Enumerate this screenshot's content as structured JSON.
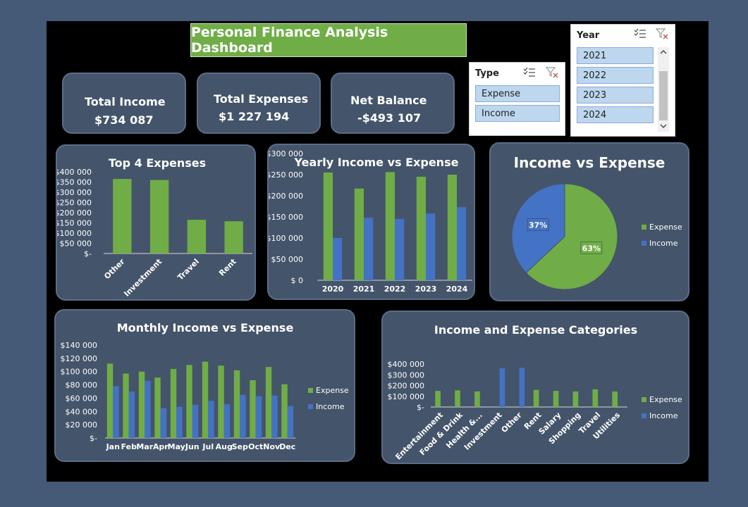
{
  "dashboard_title": "Personal Finance Analysis Dashboard",
  "kpis": {
    "income_label": "Total Income",
    "income_value": "$734 087",
    "expenses_label": "Total Expenses",
    "expenses_value": "$1 227 194",
    "net_label": "Net Balance",
    "net_value": "-$493 107"
  },
  "slicers": {
    "type": {
      "header": "Type",
      "items": [
        "Expense",
        "Income"
      ]
    },
    "year": {
      "header": "Year",
      "items": [
        "2021",
        "2022",
        "2023",
        "2024"
      ]
    }
  },
  "colors": {
    "expense": "#70ad47",
    "income": "#4472c4",
    "card": "#44546a",
    "title_bg": "#70ad47"
  },
  "chart_data": [
    {
      "id": "top4",
      "type": "bar",
      "title": "Top 4 Expenses",
      "categories": [
        "Other",
        "Investment",
        "Travel",
        "Rent"
      ],
      "values": [
        365000,
        360000,
        165000,
        158000
      ],
      "yticks": [
        "$400 000",
        "$350 000",
        "$300 000",
        "$250 000",
        "$200 000",
        "$150 000",
        "$100 000",
        "$50 000",
        "$-"
      ],
      "ylim": [
        0,
        400000
      ],
      "grid": false
    },
    {
      "id": "yearly",
      "type": "bar",
      "title": "Yearly Income vs Expense",
      "categories": [
        "2020",
        "2021",
        "2022",
        "2023",
        "2024"
      ],
      "series": [
        {
          "name": "Expense",
          "values": [
            255000,
            217000,
            256000,
            245000,
            250000
          ]
        },
        {
          "name": "Income",
          "values": [
            100000,
            148000,
            145000,
            158000,
            173000
          ]
        }
      ],
      "yticks": [
        "$300 000",
        "$250 000",
        "$200 000",
        "$150 000",
        "$100 000",
        "$50 000",
        "$ 0"
      ],
      "ylim": [
        0,
        300000
      ],
      "grid": false
    },
    {
      "id": "pie",
      "type": "pie",
      "title": "Income vs Expense",
      "labels": [
        "Expense",
        "Income"
      ],
      "values": [
        63,
        37
      ],
      "data_labels": [
        "63%",
        "37%"
      ],
      "legend": "right"
    },
    {
      "id": "monthly",
      "type": "bar",
      "title": "Monthly Income vs Expense",
      "categories": [
        "Jan",
        "Feb",
        "Mar",
        "Apr",
        "May",
        "Jun",
        "Jul",
        "Aug",
        "Sep",
        "Oct",
        "Nov",
        "Dec"
      ],
      "series": [
        {
          "name": "Expense",
          "values": [
            112000,
            97000,
            100000,
            91000,
            104000,
            110000,
            115000,
            109000,
            102000,
            87000,
            107000,
            81000
          ]
        },
        {
          "name": "Income",
          "values": [
            78000,
            70000,
            86000,
            45000,
            47000,
            50000,
            56000,
            51000,
            65000,
            63000,
            64000,
            48000
          ]
        }
      ],
      "yticks": [
        "$140 000",
        "$120 000",
        "$100 000",
        "$80 000",
        "$60 000",
        "$40 000",
        "$20 000",
        "$-"
      ],
      "ylim": [
        0,
        140000
      ],
      "legend": "right"
    },
    {
      "id": "categories",
      "type": "bar",
      "title": "Income and  Expense Categories",
      "categories": [
        "Entertainment",
        "Food & Drink",
        "Health &...",
        "Investment",
        "Other",
        "Rent",
        "Salary",
        "Shopping",
        "Travel",
        "Utilities"
      ],
      "series": [
        {
          "name": "Expense",
          "values": [
            150000,
            155000,
            145000,
            0,
            0,
            160000,
            150000,
            145000,
            165000,
            145000
          ]
        },
        {
          "name": "Income",
          "values": [
            0,
            0,
            0,
            360000,
            365000,
            0,
            0,
            0,
            0,
            0
          ]
        }
      ],
      "yticks": [
        "$400 000",
        "$300 000",
        "$200 000",
        "$100 000",
        "$-"
      ],
      "ylim": [
        0,
        400000
      ],
      "legend": "right"
    }
  ]
}
